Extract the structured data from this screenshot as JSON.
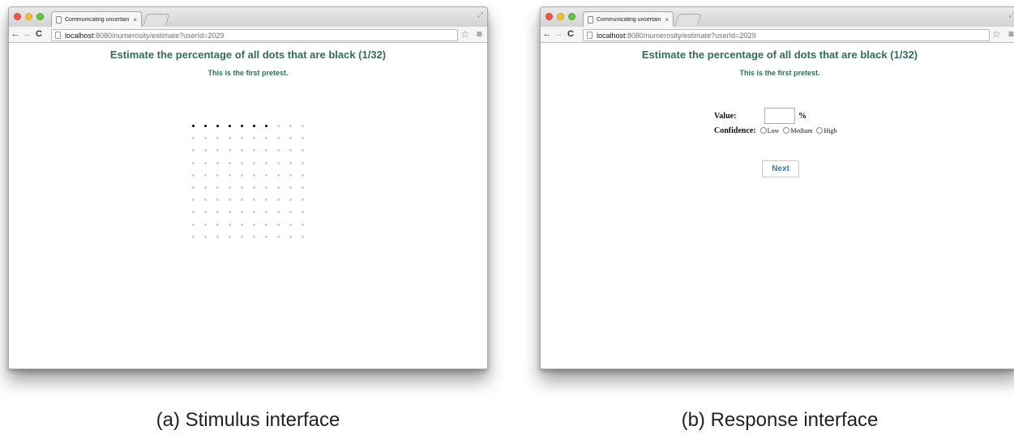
{
  "browser": {
    "tab_title": "Communicating uncertain",
    "tab_close": "×",
    "url_host": "localhost",
    "url_path": ":8080/numerosity/estimate?userId=2029"
  },
  "page": {
    "heading": "Estimate the percentage of all dots that are black (1/32)",
    "subheading": "This is the first pretest."
  },
  "stimulus": {
    "rows": 10,
    "cols": 10,
    "black_count": 7,
    "colors": {
      "black": "#000000",
      "gray": "#cccccc"
    }
  },
  "response": {
    "value_label": "Value:",
    "value_input": "",
    "percent_sign": "%",
    "confidence_label": "Confidence:",
    "options": [
      "Low",
      "Medium",
      "High"
    ],
    "next_label": "Next"
  },
  "captions": {
    "a": "(a) Stimulus interface",
    "b": "(b) Response interface"
  },
  "colors": {
    "heading": "#2e6e5c",
    "next_button_text": "#3a78a6"
  }
}
